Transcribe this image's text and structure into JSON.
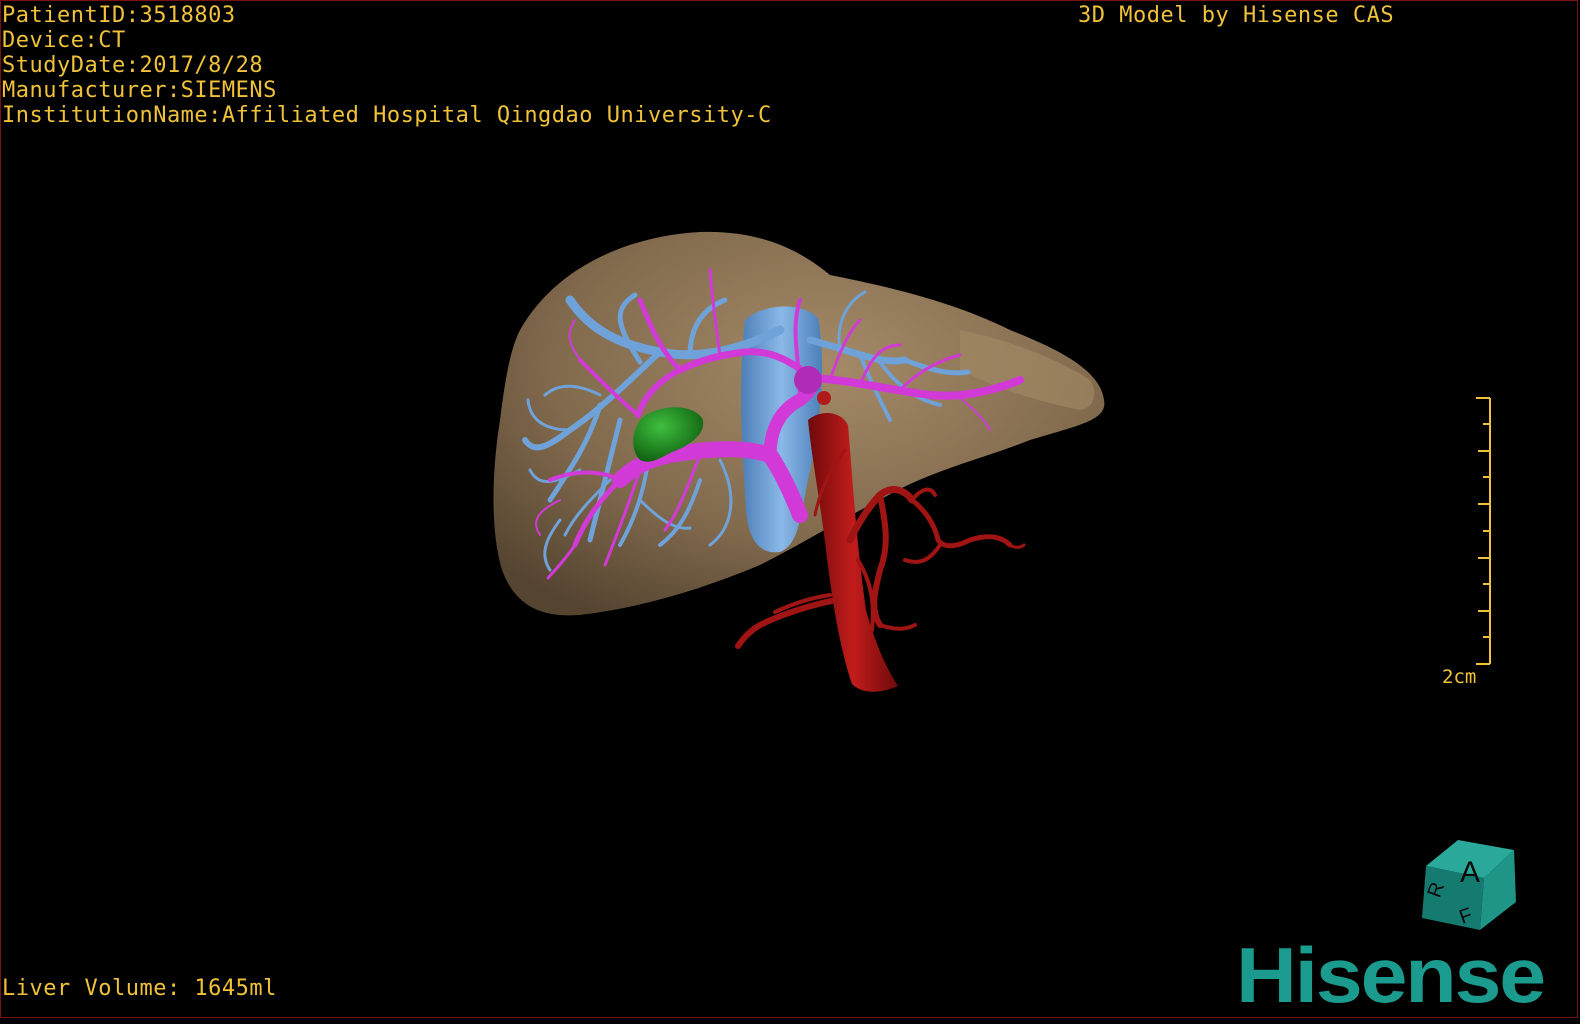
{
  "overlay": {
    "patient_id": "PatientID:3518803",
    "device": "Device:CT",
    "study_date": "StudyDate:2017/8/28",
    "manufacturer": "Manufacturer:SIEMENS",
    "institution": "InstitutionName:Affiliated Hospital Qingdao University-C",
    "credit": "3D Model by Hisense CAS",
    "liver_volume": "Liver Volume: 1645ml",
    "scale_label": "2cm"
  },
  "orientation_cube": {
    "face_top": "A",
    "face_left": "R",
    "face_bottom": "F"
  },
  "logo": {
    "text": "Hisense",
    "color": "#1b9a8e"
  },
  "colors": {
    "text": "#f0c23a",
    "liver": "#8b7355",
    "hepatic_vein": "#6ea2d8",
    "portal_vein": "#d23ad8",
    "artery": "#a01414",
    "gallbladder": "#1e8a1e",
    "frame": "#7a1010"
  }
}
